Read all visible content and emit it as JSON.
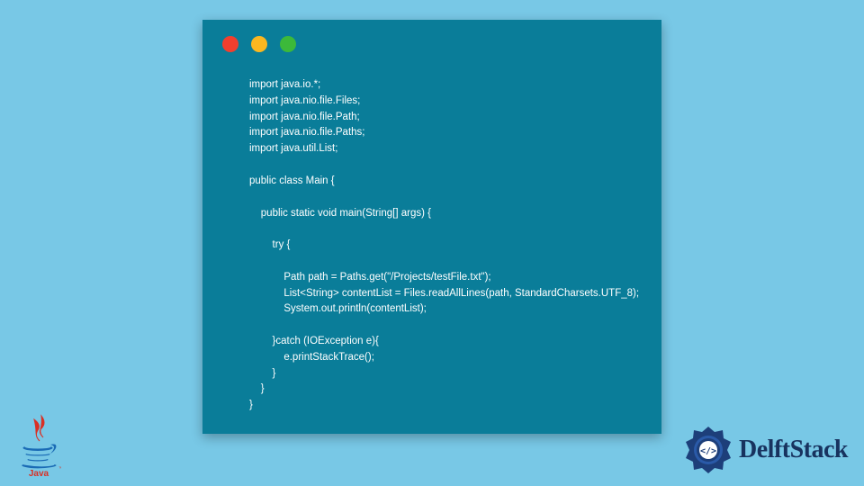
{
  "code": {
    "lines": [
      "import java.io.*;",
      "import java.nio.file.Files;",
      "import java.nio.file.Path;",
      "import java.nio.file.Paths;",
      "import java.util.List;",
      "",
      "public class Main {",
      "",
      "    public static void main(String[] args) {",
      "",
      "        try {",
      "",
      "            Path path = Paths.get(\"/Projects/testFile.txt\");",
      "            List<String> contentList = Files.readAllLines(path, StandardCharsets.UTF_8);",
      "            System.out.println(contentList);",
      "",
      "        }catch (IOException e){",
      "            e.printStackTrace();",
      "        }",
      "    }",
      "}"
    ]
  },
  "brand": {
    "name": "DelftStack"
  },
  "colors": {
    "bg": "#78c8e6",
    "window": "#0a7d99",
    "red": "#f23f2e",
    "yellow": "#fbb720",
    "green": "#3cb93a",
    "brandText": "#18335f"
  }
}
